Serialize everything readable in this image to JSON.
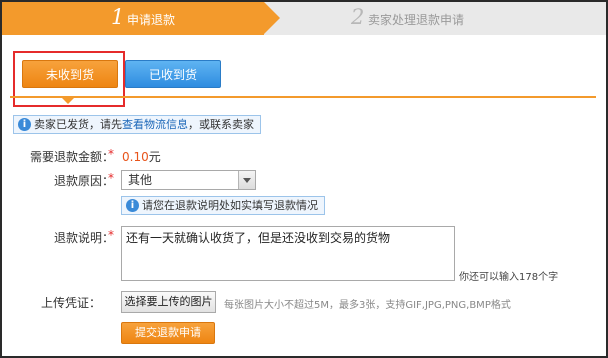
{
  "steps": {
    "step1": {
      "number": "1",
      "label": "申请退款"
    },
    "step2": {
      "number": "2",
      "label": "卖家处理退款申请"
    }
  },
  "tabs": {
    "unreceived": "未收到货",
    "received": "已收到货"
  },
  "notice": {
    "prefix": "卖家已发货，请先",
    "link": "查看物流信息",
    "suffix": "，或联系卖家"
  },
  "form": {
    "amount_label": "需要退款金额：",
    "amount_value": "0.10",
    "amount_unit": "元",
    "reason_label": "退款原因：",
    "reason_selected": "其他",
    "reason_hint": "请您在退款说明处如实填写退款情况",
    "desc_label": "退款说明：",
    "desc_value": "还有一天就确认收货了，但是还没收到交易的货物",
    "desc_counter": "你还可以输入178个字",
    "upload_label": "上传凭证：",
    "upload_button": "选择要上传的图片",
    "upload_hint": "每张图片大小不超过5M，最多3张，支持GIF,JPG,PNG,BMP格式",
    "submit": "提交退款申请",
    "required_mark": "*"
  },
  "colors": {
    "accent": "#f39a2c",
    "blue": "#2e8ce0",
    "required": "#e52b2b",
    "highlight": "#e52b2b"
  }
}
